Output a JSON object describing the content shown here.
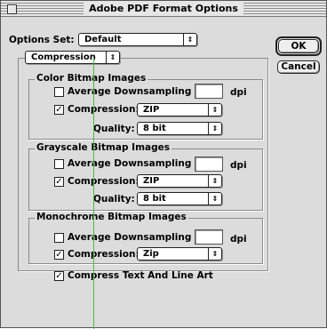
{
  "window": {
    "title": "Adobe PDF Format Options"
  },
  "options_set": {
    "label": "Options Set:",
    "value": "Default"
  },
  "buttons": {
    "ok": "OK",
    "cancel": "Cancel"
  },
  "panel_selector": {
    "value": "Compression"
  },
  "groups": [
    {
      "title": "Color Bitmap Images",
      "downsampling_label": "Average Downsampling at:",
      "downsampling_checked": false,
      "dpi_value": "",
      "dpi_unit": "dpi",
      "compression_label": "Compression:",
      "compression_checked": true,
      "compression_value": "ZIP",
      "quality_label": "Quality:",
      "quality_value": "8 bit"
    },
    {
      "title": "Grayscale Bitmap Images",
      "downsampling_label": "Average Downsampling at:",
      "downsampling_checked": false,
      "dpi_value": "",
      "dpi_unit": "dpi",
      "compression_label": "Compression:",
      "compression_checked": true,
      "compression_value": "ZIP",
      "quality_label": "Quality:",
      "quality_value": "8 bit"
    },
    {
      "title": "Monochrome Bitmap Images",
      "downsampling_label": "Average Downsampling at:",
      "downsampling_checked": false,
      "dpi_value": "",
      "dpi_unit": "dpi",
      "compression_label": "Compression:",
      "compression_checked": true,
      "compression_value": "Zip"
    }
  ],
  "compress_text": {
    "label": "Compress Text And Line Art",
    "checked": true
  },
  "icons": {
    "popup_arrows": "updown-arrows-icon",
    "close": "close-box-icon",
    "check": "checkmark-icon"
  },
  "colors": {
    "window_bg": "#dcdcdc",
    "guide_line": "#3cc43c"
  }
}
